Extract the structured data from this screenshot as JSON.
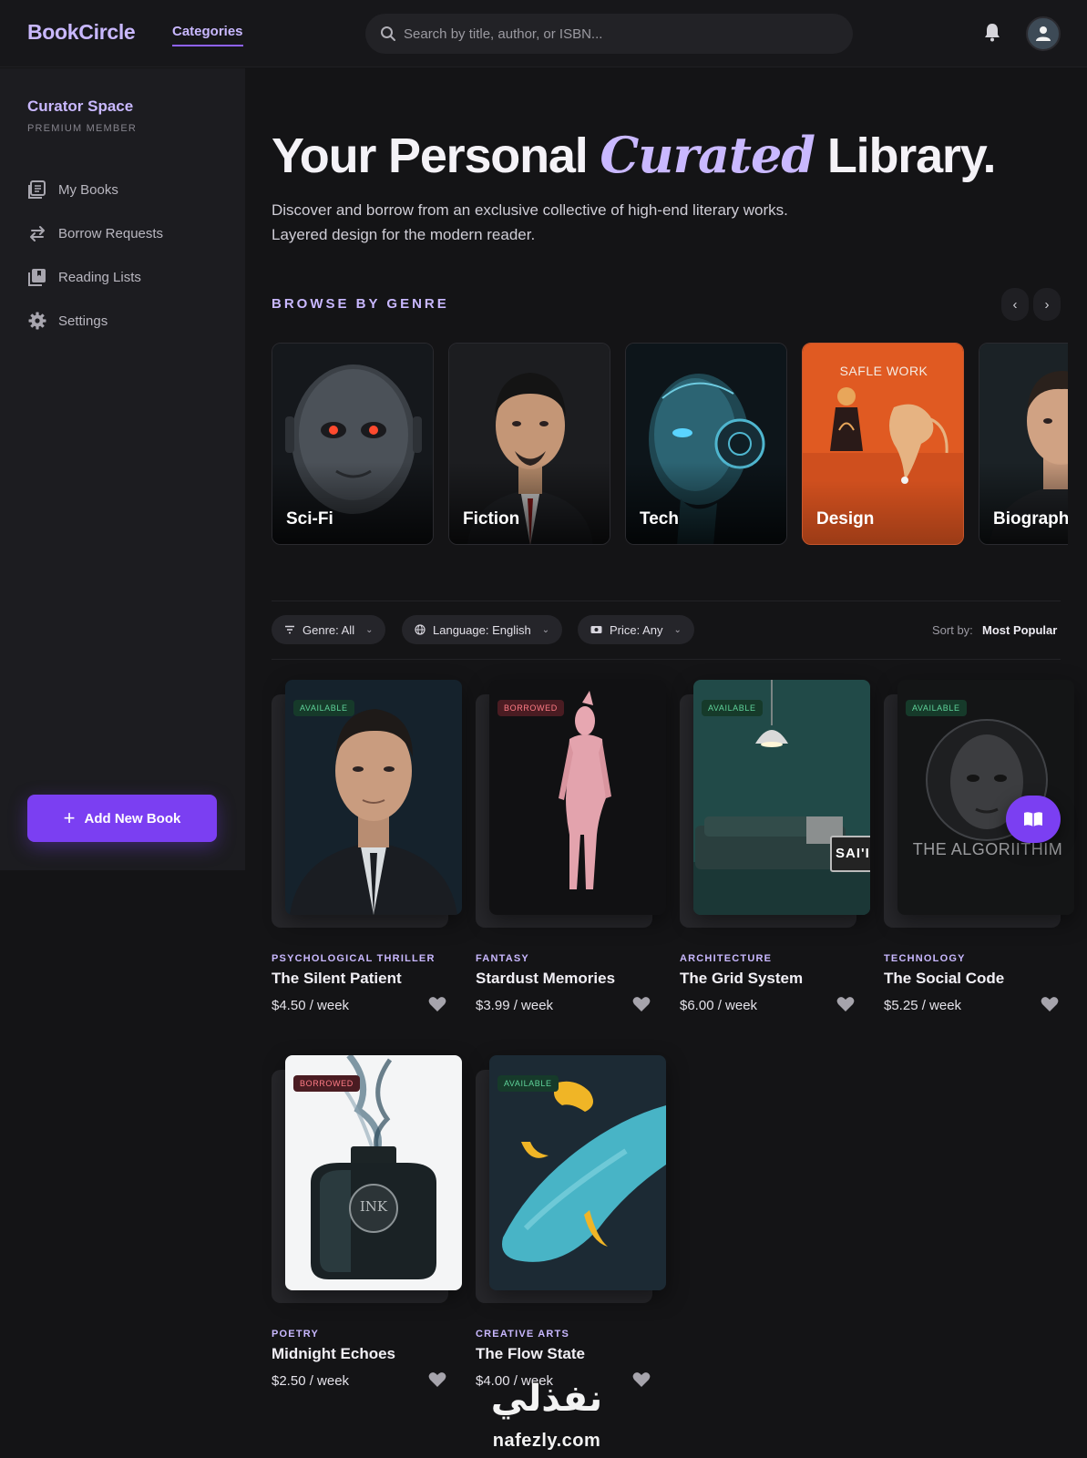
{
  "header": {
    "brand": "BookCircle",
    "nav_categories": "Categories",
    "search_placeholder": "Search by title, author, or ISBN..."
  },
  "sidebar": {
    "title": "Curator Space",
    "subtitle": "PREMIUM MEMBER",
    "items": [
      {
        "label": "My Books",
        "icon": "book-list-icon"
      },
      {
        "label": "Borrow Requests",
        "icon": "swap-arrows-icon"
      },
      {
        "label": "Reading Lists",
        "icon": "library-icon"
      },
      {
        "label": "Settings",
        "icon": "gear-icon"
      }
    ],
    "add_button": "Add New Book"
  },
  "hero": {
    "title_part1": "Your Personal",
    "title_accent": "Curated",
    "title_part2": "Library.",
    "desc_line1": "Discover and borrow from an exclusive collective of high-end literary works.",
    "desc_line2": "Layered design for the modern reader."
  },
  "genres": {
    "heading": "BROWSE BY GENRE",
    "items": [
      "Sci-Fi",
      "Fiction",
      "Tech",
      "Design",
      "Biograph"
    ],
    "design_card_text": "SAFLE WORK"
  },
  "filters": {
    "genre": "Genre: All",
    "language": "Language: English",
    "price": "Price: Any",
    "sort_label": "Sort by:",
    "sort_value": "Most Popular"
  },
  "books": [
    {
      "category": "PSYCHOLOGICAL THRILLER",
      "title": "The Silent Patient",
      "price": "$4.50 / week",
      "status": "AVAILABLE"
    },
    {
      "category": "FANTASY",
      "title": "Stardust Memories",
      "price": "$3.99 / week",
      "status": "BORROWED"
    },
    {
      "category": "ARCHITECTURE",
      "title": "The Grid System",
      "price": "$6.00 / week",
      "status": "AVAILABLE",
      "cover_text": "SAI'I"
    },
    {
      "category": "TECHNOLOGY",
      "title": "The Social Code",
      "price": "$5.25 / week",
      "status": "AVAILABLE",
      "cover_text": "THE ALGORIITHIM"
    },
    {
      "category": "POETRY",
      "title": "Midnight Echoes",
      "price": "$2.50 / week",
      "status": "BORROWED",
      "cover_text": "INK"
    },
    {
      "category": "CREATIVE ARTS",
      "title": "The Flow State",
      "price": "$4.00 / week",
      "status": "AVAILABLE"
    }
  ],
  "watermark": {
    "arabic": "نفذلي",
    "latin": "nafezly.com"
  },
  "colors": {
    "accent": "#c9b8ff",
    "primary": "#7b3ff2",
    "background": "#141416",
    "available": "#5fd39a",
    "borrowed": "#ff7c86"
  }
}
